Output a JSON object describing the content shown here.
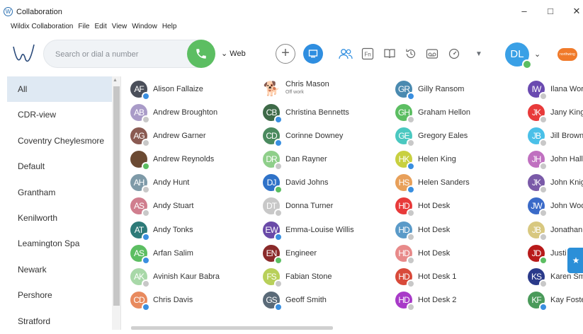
{
  "window": {
    "title": "Collaboration",
    "minimize": "–",
    "maximize": "□",
    "close": "✕"
  },
  "menu": [
    "Wildix Collaboration",
    "File",
    "Edit",
    "View",
    "Window",
    "Help"
  ],
  "toolbar": {
    "search_placeholder": "Search or dial a number",
    "device_select": "Web",
    "user_initials": "DL",
    "brand_badge": "northwing"
  },
  "sidebar": {
    "items": [
      {
        "label": "All",
        "active": true
      },
      {
        "label": "CDR-view"
      },
      {
        "label": "Coventry Cheylesmore"
      },
      {
        "label": "Default"
      },
      {
        "label": "Grantham"
      },
      {
        "label": "Kenilworth"
      },
      {
        "label": "Leamington Spa"
      },
      {
        "label": "Newark"
      },
      {
        "label": "Pershore"
      },
      {
        "label": "Stratford"
      }
    ]
  },
  "contacts": {
    "columns": [
      [
        {
          "initials": "AF",
          "name": "Alison Fallaize",
          "color": "#4a4f5a",
          "status": "#3a8fe0"
        },
        {
          "initials": "AB",
          "name": "Andrew Broughton",
          "color": "#a99bc8",
          "status": "#c8c8c8"
        },
        {
          "initials": "AG",
          "name": "Andrew Garner",
          "color": "#8a5a52",
          "status": "#c8c8c8"
        },
        {
          "initials": "",
          "name": "Andrew Reynolds",
          "color": "#6b4a33",
          "status": "#5cbe62",
          "photo": true
        },
        {
          "initials": "AH",
          "name": "Andy Hunt",
          "color": "#7e9aa8",
          "status": "#c8c8c8"
        },
        {
          "initials": "AS",
          "name": "Andy Stuart",
          "color": "#d07e8e",
          "status": "#c8c8c8"
        },
        {
          "initials": "AT",
          "name": "Andy Tonks",
          "color": "#2d7a78",
          "status": "#3a8fe0"
        },
        {
          "initials": "AS",
          "name": "Arfan Salim",
          "color": "#5cbe62",
          "status": "#3a8fe0"
        },
        {
          "initials": "AK",
          "name": "Avinish Kaur Babra",
          "color": "#a8d8a8",
          "status": "#c8c8c8"
        },
        {
          "initials": "CD",
          "name": "Chris Davis",
          "color": "#e88a5e",
          "status": "#3a8fe0"
        }
      ],
      [
        {
          "initials": "🐕",
          "name": "Chris Mason",
          "sub": "Off work",
          "color": "transparent",
          "status": "",
          "dog": true
        },
        {
          "initials": "CB",
          "name": "Christina Bennetts",
          "color": "#3e6a48",
          "status": "#3a8fe0"
        },
        {
          "initials": "CD",
          "name": "Corinne Downey",
          "color": "#4a8a5e",
          "status": "#3a8fe0"
        },
        {
          "initials": "DR",
          "name": "Dan Rayner",
          "color": "#8fcf8a",
          "status": "#c8c8c8"
        },
        {
          "initials": "DJ",
          "name": "David Johns",
          "color": "#2f72c8",
          "status": "#5cbe62"
        },
        {
          "initials": "DT",
          "name": "Donna Turner",
          "color": "#c8c8c8",
          "status": "#c8c8c8"
        },
        {
          "initials": "EW",
          "name": "Emma-Louise Willis",
          "color": "#6a4aa8",
          "status": "#3a8fe0"
        },
        {
          "initials": "EN",
          "name": "Engineer",
          "color": "#8a2a2a",
          "status": "#5cbe62"
        },
        {
          "initials": "FS",
          "name": "Fabian Stone",
          "color": "#b8d05a",
          "status": "#c8c8c8"
        },
        {
          "initials": "GS",
          "name": "Geoff Smith",
          "color": "#5a6a78",
          "status": "#3a8fe0"
        }
      ],
      [
        {
          "initials": "GR",
          "name": "Gilly Ransom",
          "color": "#4a8ab0",
          "status": "#3a8fe0"
        },
        {
          "initials": "GH",
          "name": "Graham Hellon",
          "color": "#5cbe62",
          "status": "#c8c8c8"
        },
        {
          "initials": "GE",
          "name": "Gregory Eales",
          "color": "#4ac8c0",
          "status": "#c8c8c8"
        },
        {
          "initials": "HK",
          "name": "Helen King",
          "color": "#c8d040",
          "status": "#3a8fe0"
        },
        {
          "initials": "HS",
          "name": "Helen Sanders",
          "color": "#e8a05a",
          "status": "#3a8fe0"
        },
        {
          "initials": "HD",
          "name": "Hot Desk",
          "color": "#e83a3a",
          "status": "#c8c8c8"
        },
        {
          "initials": "HD",
          "name": "Hot Desk",
          "color": "#5a9ac8",
          "status": "#c8c8c8"
        },
        {
          "initials": "HD",
          "name": "Hot Desk",
          "color": "#e88a8a",
          "status": "#c8c8c8"
        },
        {
          "initials": "HD",
          "name": "Hot Desk 1",
          "color": "#d84a3a",
          "status": "#c8c8c8"
        },
        {
          "initials": "HD",
          "name": "Hot Desk 2",
          "color": "#a83ac8",
          "status": "#c8c8c8"
        }
      ],
      [
        {
          "initials": "IW",
          "name": "Ilana Wor",
          "color": "#6a4ab0",
          "status": "#c8c8c8"
        },
        {
          "initials": "JK",
          "name": "Jany King",
          "color": "#e83a3a",
          "status": "#c8c8c8"
        },
        {
          "initials": "JB",
          "name": "Jill Brown",
          "color": "#4ac0e8",
          "status": "#c8c8c8"
        },
        {
          "initials": "JH",
          "name": "John Hall",
          "color": "#c070c0",
          "status": "#c8c8c8"
        },
        {
          "initials": "JK",
          "name": "John Knig",
          "color": "#7a5aa8",
          "status": "#c8c8c8"
        },
        {
          "initials": "JW",
          "name": "John Woo",
          "color": "#3a6ac8",
          "status": "#c8c8c8"
        },
        {
          "initials": "JB",
          "name": "Jonathan",
          "color": "#d8c880",
          "status": "#c8c8c8"
        },
        {
          "initials": "JD",
          "name": "Justi",
          "color": "#b81a1a",
          "status": "#5cbe62"
        },
        {
          "initials": "KS",
          "name": "Karen Sm",
          "color": "#2a3a8a",
          "status": "#c8c8c8"
        },
        {
          "initials": "KF",
          "name": "Kay Foste",
          "color": "#4a9a5a",
          "status": "#3a8fe0"
        }
      ]
    ]
  }
}
